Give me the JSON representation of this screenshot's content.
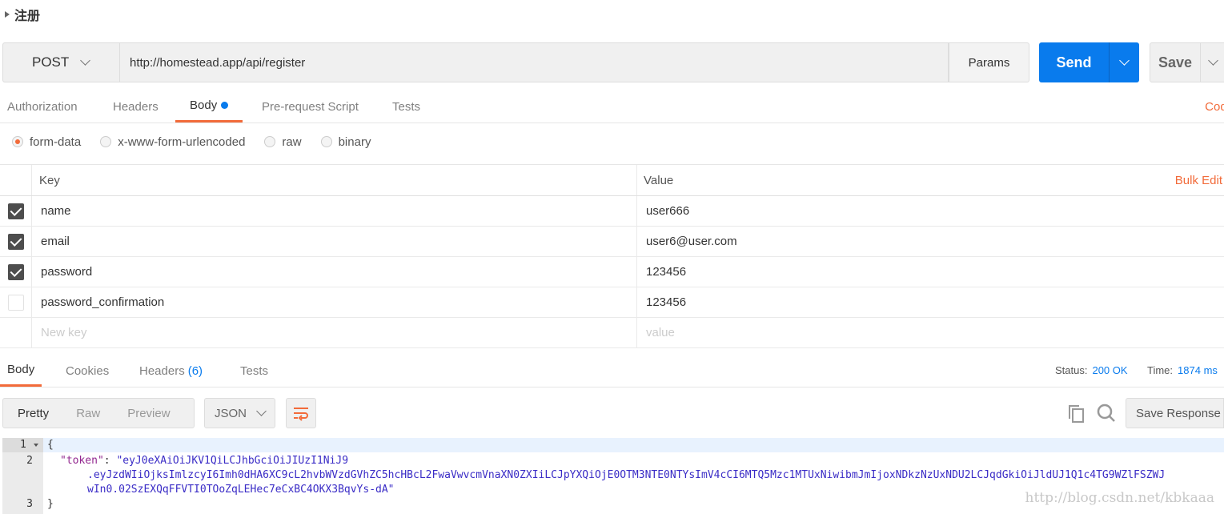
{
  "request": {
    "name": "注册",
    "method": "POST",
    "url": "http://homestead.app/api/register",
    "params_label": "Params",
    "send_label": "Send",
    "save_label": "Save"
  },
  "request_tabs": {
    "authorization": "Authorization",
    "headers": "Headers",
    "body": "Body",
    "prerequest": "Pre-request Script",
    "tests": "Tests",
    "code": "Code"
  },
  "body_types": {
    "form_data": "form-data",
    "urlencoded": "x-www-form-urlencoded",
    "raw": "raw",
    "binary": "binary",
    "selected": "form-data"
  },
  "kv_table": {
    "key_header": "Key",
    "value_header": "Value",
    "bulk_edit": "Bulk Edit",
    "rows": [
      {
        "checked": true,
        "key": "name",
        "value": "user666"
      },
      {
        "checked": true,
        "key": "email",
        "value": "user6@user.com"
      },
      {
        "checked": true,
        "key": "password",
        "value": "123456"
      },
      {
        "checked": false,
        "key": "password_confirmation",
        "value": "123456"
      }
    ],
    "new_key_placeholder": "New key",
    "new_value_placeholder": "value"
  },
  "response_tabs": {
    "body": "Body",
    "cookies": "Cookies",
    "headers": "Headers",
    "headers_count": "(6)",
    "tests": "Tests"
  },
  "response_meta": {
    "status_label": "Status:",
    "status_value": "200 OK",
    "time_label": "Time:",
    "time_value": "1874 ms"
  },
  "response_toolbar": {
    "pretty": "Pretty",
    "raw": "Raw",
    "preview": "Preview",
    "format": "JSON",
    "save_response": "Save Response"
  },
  "response_body": {
    "open_brace": "{",
    "close_brace": "}",
    "token_key": "\"token\"",
    "token_part1": "\"eyJ0eXAiOiJKV1QiLCJhbGciOiJIUzI1NiJ9",
    "token_part2": ".eyJzdWIiOjksImlzcyI6Imh0dHA6XC9cL2hvbWVzdGVhZC5hcHBcL2FwaVwvcmVnaXN0ZXIiLCJpYXQiOjE0OTM3NTE0NTYsImV4cCI6MTQ5Mzc1MTUxNiwibmJmIjoxNDkzNzUxNDU2LCJqdGkiOiJldUJ1Q1c4TG9WZlFSZWJ",
    "token_part3": "wIn0.02SzEXQqFFVTI0TOoZqLEHec7eCxBC4OKX3BqvYs-dA\"",
    "line_numbers": [
      "1",
      "2",
      "3"
    ]
  },
  "watermark": "http://blog.csdn.net/kbkaaa",
  "colors": {
    "accent": "#f26b3a",
    "primary": "#097bed"
  }
}
